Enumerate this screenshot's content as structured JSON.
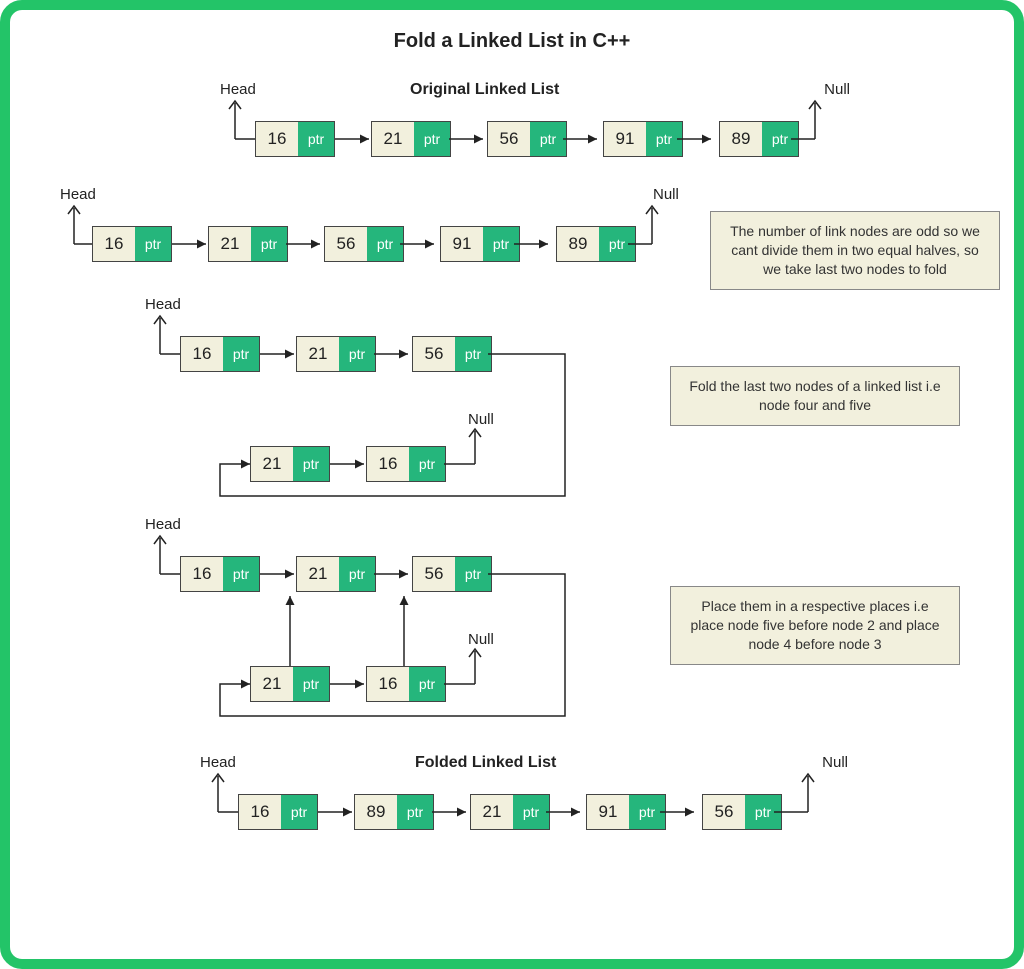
{
  "title": "Fold a Linked List in C++",
  "labels": {
    "head": "Head",
    "null": "Null",
    "original": "Original Linked List",
    "folded": "Folded Linked List",
    "ptr": "ptr"
  },
  "lists": {
    "orig": [
      16,
      21,
      56,
      91,
      89
    ],
    "fold_top": [
      16,
      21,
      56
    ],
    "fold_bot": [
      21,
      16
    ],
    "final": [
      16,
      89,
      21,
      91,
      56
    ]
  },
  "explanations": {
    "e1": "The number of link nodes are odd so we cant divide them in two equal halves, so we take last two nodes to fold",
    "e2": "Fold the last two nodes of  a linked list i.e node four and five",
    "e3": "Place them in a respective places i.e place node five before node 2 and place node 4 before node 3"
  }
}
